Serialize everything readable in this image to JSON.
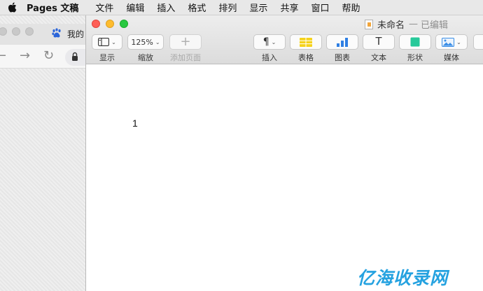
{
  "menubar": {
    "app_name": "Pages 文稿",
    "items": [
      "文件",
      "编辑",
      "插入",
      "格式",
      "排列",
      "显示",
      "共享",
      "窗口",
      "帮助"
    ]
  },
  "browser": {
    "tab_title": "我的"
  },
  "window": {
    "doc_title": "未命名",
    "separator": "—",
    "doc_state": "已编辑"
  },
  "toolbar": {
    "view_label": "显示",
    "zoom_value": "125%",
    "zoom_label": "缩放",
    "add_page_label": "添加页面",
    "insert_glyph": "¶",
    "insert_label": "插入",
    "table_label": "表格",
    "chart_label": "图表",
    "text_glyph": "T",
    "text_label": "文本",
    "shape_label": "形状",
    "media_label": "媒体"
  },
  "document": {
    "page_number": "1"
  },
  "watermark": {
    "text": "亿海收录网"
  },
  "colors": {
    "close": "#fe5f57",
    "minimize": "#febc2e",
    "maximize": "#28c840",
    "table_icon": "#f5d21b",
    "chart_icon": "#2f7fe3",
    "shape_icon": "#27c99a",
    "media_icon": "#3a8ee6",
    "watermark": "#25a2e0"
  }
}
